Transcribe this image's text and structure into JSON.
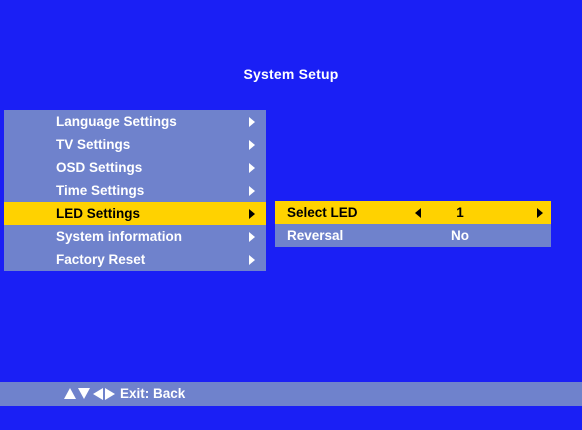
{
  "colors": {
    "background": "#1a1ff5",
    "panel": "#6f82cc",
    "highlight": "#ffd200",
    "text": "#ffffff",
    "highlight_text": "#000000"
  },
  "header": {
    "title": "System Setup"
  },
  "menu": {
    "selected_index": 4,
    "items": [
      {
        "label": "Language Settings",
        "icon": "chevron-right-icon"
      },
      {
        "label": "TV Settings",
        "icon": "chevron-right-icon"
      },
      {
        "label": "OSD Settings",
        "icon": "chevron-right-icon"
      },
      {
        "label": "Time Settings",
        "icon": "chevron-right-icon"
      },
      {
        "label": "LED Settings",
        "icon": "chevron-right-icon"
      },
      {
        "label": "System information",
        "icon": "chevron-right-icon"
      },
      {
        "label": "Factory Reset",
        "icon": "chevron-right-icon"
      }
    ]
  },
  "submenu": {
    "selected_index": 0,
    "items": [
      {
        "label": "Select LED",
        "value": "1"
      },
      {
        "label": "Reversal",
        "value": "No"
      }
    ]
  },
  "footer": {
    "nav_icons": [
      "arrow-up-icon",
      "arrow-down-icon",
      "arrow-left-icon",
      "arrow-right-icon"
    ],
    "hint": "Exit: Back"
  }
}
